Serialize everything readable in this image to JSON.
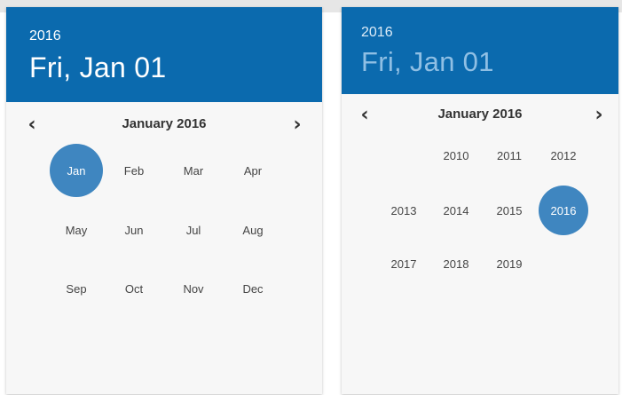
{
  "month_view": {
    "header": {
      "year": "2016",
      "date": "Fri, Jan 01"
    },
    "nav": {
      "title": "January 2016",
      "prev": "‹",
      "next": "›"
    },
    "months": [
      "Jan",
      "Feb",
      "Mar",
      "Apr",
      "May",
      "Jun",
      "Jul",
      "Aug",
      "Sep",
      "Oct",
      "Nov",
      "Dec"
    ],
    "selected": "Jan"
  },
  "year_view": {
    "header": {
      "year": "2016",
      "date": "Fri, Jan 01"
    },
    "nav": {
      "title": "January 2016",
      "prev": "‹",
      "next": "›"
    },
    "years": [
      "2010",
      "2011",
      "2012",
      "2013",
      "2014",
      "2015",
      "2016",
      "2017",
      "2018",
      "2019"
    ],
    "selected": "2016"
  },
  "colors": {
    "header_bg": "#0b6aae",
    "selected_bg": "#3f86c0"
  }
}
